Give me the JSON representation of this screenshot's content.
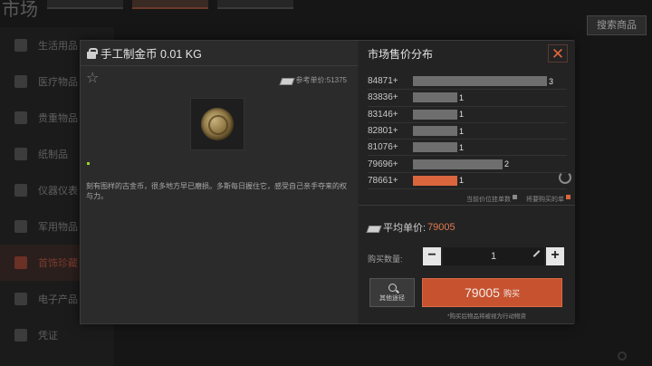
{
  "background": {
    "title": "市场",
    "search_label": "搜索商品",
    "sidebar": [
      {
        "label": "生活用品",
        "selected": false
      },
      {
        "label": "医疗物品",
        "selected": false
      },
      {
        "label": "贵重物品",
        "selected": false
      },
      {
        "label": "纸制品",
        "selected": false
      },
      {
        "label": "仪器仪表",
        "selected": false
      },
      {
        "label": "军用物品",
        "selected": false
      },
      {
        "label": "首饰珍藏",
        "selected": true
      },
      {
        "label": "电子产品",
        "selected": false
      },
      {
        "label": "凭证",
        "selected": false
      }
    ]
  },
  "item": {
    "name": "手工制金币 0.01 KG",
    "ref_price_label": "参考单价:51375",
    "description": "刻有图样的古金币，很多地方早已磨损。多斯每日握住它，感受自己亲手夺来的权与力。"
  },
  "market": {
    "title": "市场售价分布",
    "close_label": "✕",
    "legend_current": "当前价位挂单数",
    "legend_cheapest": "将要购买的单",
    "rows": [
      {
        "price": "84871+",
        "count": "3",
        "fraction": 1.0,
        "cheapest": false
      },
      {
        "price": "83836+",
        "count": "1",
        "fraction": 0.333,
        "cheapest": false
      },
      {
        "price": "83146+",
        "count": "1",
        "fraction": 0.333,
        "cheapest": false
      },
      {
        "price": "82801+",
        "count": "1",
        "fraction": 0.333,
        "cheapest": false
      },
      {
        "price": "81076+",
        "count": "1",
        "fraction": 0.333,
        "cheapest": false
      },
      {
        "price": "79696+",
        "count": "2",
        "fraction": 0.667,
        "cheapest": false
      },
      {
        "price": "78661+",
        "count": "1",
        "fraction": 0.333,
        "cheapest": true
      }
    ],
    "avg_label": "平均单价:",
    "avg_value": "79005",
    "qty_label": "购买数量:",
    "qty_value": "1",
    "minus": "−",
    "plus": "+",
    "other_channel": "其他途径",
    "buy_price": "79005",
    "buy_label": "购买",
    "buy_note": "*购买后物品将被视为行动物资"
  },
  "colors": {
    "accent": "#c6522f",
    "bar": "#6e6e6e",
    "cheap_bar": "#d9663d"
  }
}
